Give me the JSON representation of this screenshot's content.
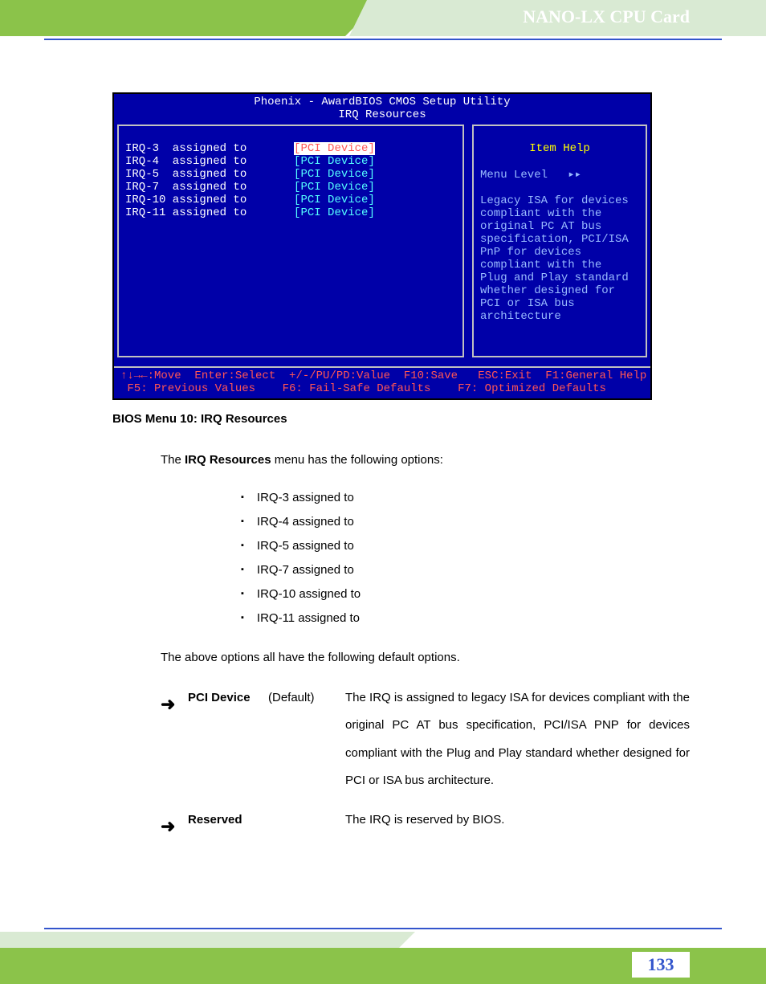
{
  "header": {
    "title": "NANO-LX CPU Card"
  },
  "footer": {
    "page": "133"
  },
  "bios": {
    "title": "Phoenix - AwardBIOS CMOS Setup Utility",
    "subtitle": "IRQ Resources",
    "irq": [
      {
        "label": "IRQ-3  assigned to",
        "value": "[PCI Device]",
        "selected": true
      },
      {
        "label": "IRQ-4  assigned to",
        "value": "[PCI Device]",
        "selected": false
      },
      {
        "label": "IRQ-5  assigned to",
        "value": "[PCI Device]",
        "selected": false
      },
      {
        "label": "IRQ-7  assigned to",
        "value": "[PCI Device]",
        "selected": false
      },
      {
        "label": "IRQ-10 assigned to",
        "value": "[PCI Device]",
        "selected": false
      },
      {
        "label": "IRQ-11 assigned to",
        "value": "[PCI Device]",
        "selected": false
      }
    ],
    "help": {
      "heading": "Item Help",
      "menulevel": "Menu Level   ▸▸",
      "text": "Legacy ISA for devices\ncompliant with the\noriginal PC AT bus\nspecification, PCI/ISA\nPnP for devices\ncompliant with the\nPlug and Play standard\nwhether designed for\nPCI or ISA bus\narchitecture"
    },
    "footer": "↑↓→←:Move  Enter:Select  +/-/PU/PD:Value  F10:Save   ESC:Exit  F1:General Help\n F5: Previous Values    F6: Fail-Safe Defaults    F7: Optimized Defaults"
  },
  "doc": {
    "caption": "BIOS Menu 10: IRQ Resources",
    "intro_pre": "The ",
    "intro_bold": "IRQ Resources",
    "intro_post": " menu has the following options:",
    "bullets": [
      "IRQ-3 assigned to",
      "IRQ-4 assigned to",
      "IRQ-5 assigned to",
      "IRQ-7 assigned to",
      "IRQ-10 assigned to",
      "IRQ-11 assigned to"
    ],
    "para2": "The above options all have the following default options.",
    "options": [
      {
        "arrow": "➜",
        "name": "PCI Device",
        "default": "(Default)",
        "desc": "The IRQ is assigned to legacy ISA for devices compliant with the original PC AT bus specification, PCI/ISA PNP for devices compliant with the Plug and Play standard whether designed for PCI or ISA bus architecture."
      },
      {
        "arrow": "➜",
        "name": "Reserved",
        "default": "",
        "desc": "The IRQ is reserved by BIOS."
      }
    ]
  }
}
